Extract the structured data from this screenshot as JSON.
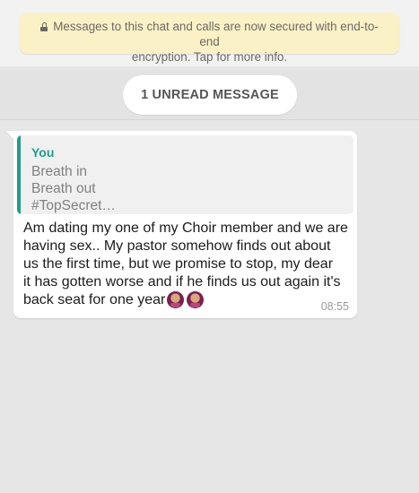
{
  "banner": {
    "line1": "Messages to this chat and calls are now secured with end-to-end",
    "line2": "encryption. Tap for more info.",
    "icon": "lock-icon"
  },
  "unread": {
    "label": "1 UNREAD MESSAGE"
  },
  "message": {
    "quote": {
      "author": "You",
      "lines": [
        "Breath in",
        "Breath out",
        "#TopSecret…"
      ]
    },
    "lines": [
      "Am dating my one of my Choir member and we are",
      "having sex.. My pastor somehow finds out about",
      "us the first time, but we promise to stop, my dear",
      "it has gotten worse and if he finds us out again it's",
      "back seat for one year"
    ],
    "emojis": [
      "person-facepalming-emoji",
      "person-facepalming-emoji"
    ],
    "time": "08:55"
  },
  "colors": {
    "chat_background": "#e6e6e6",
    "banner_background": "#fbf1c7",
    "quote_accent": "#1f9e8a"
  }
}
